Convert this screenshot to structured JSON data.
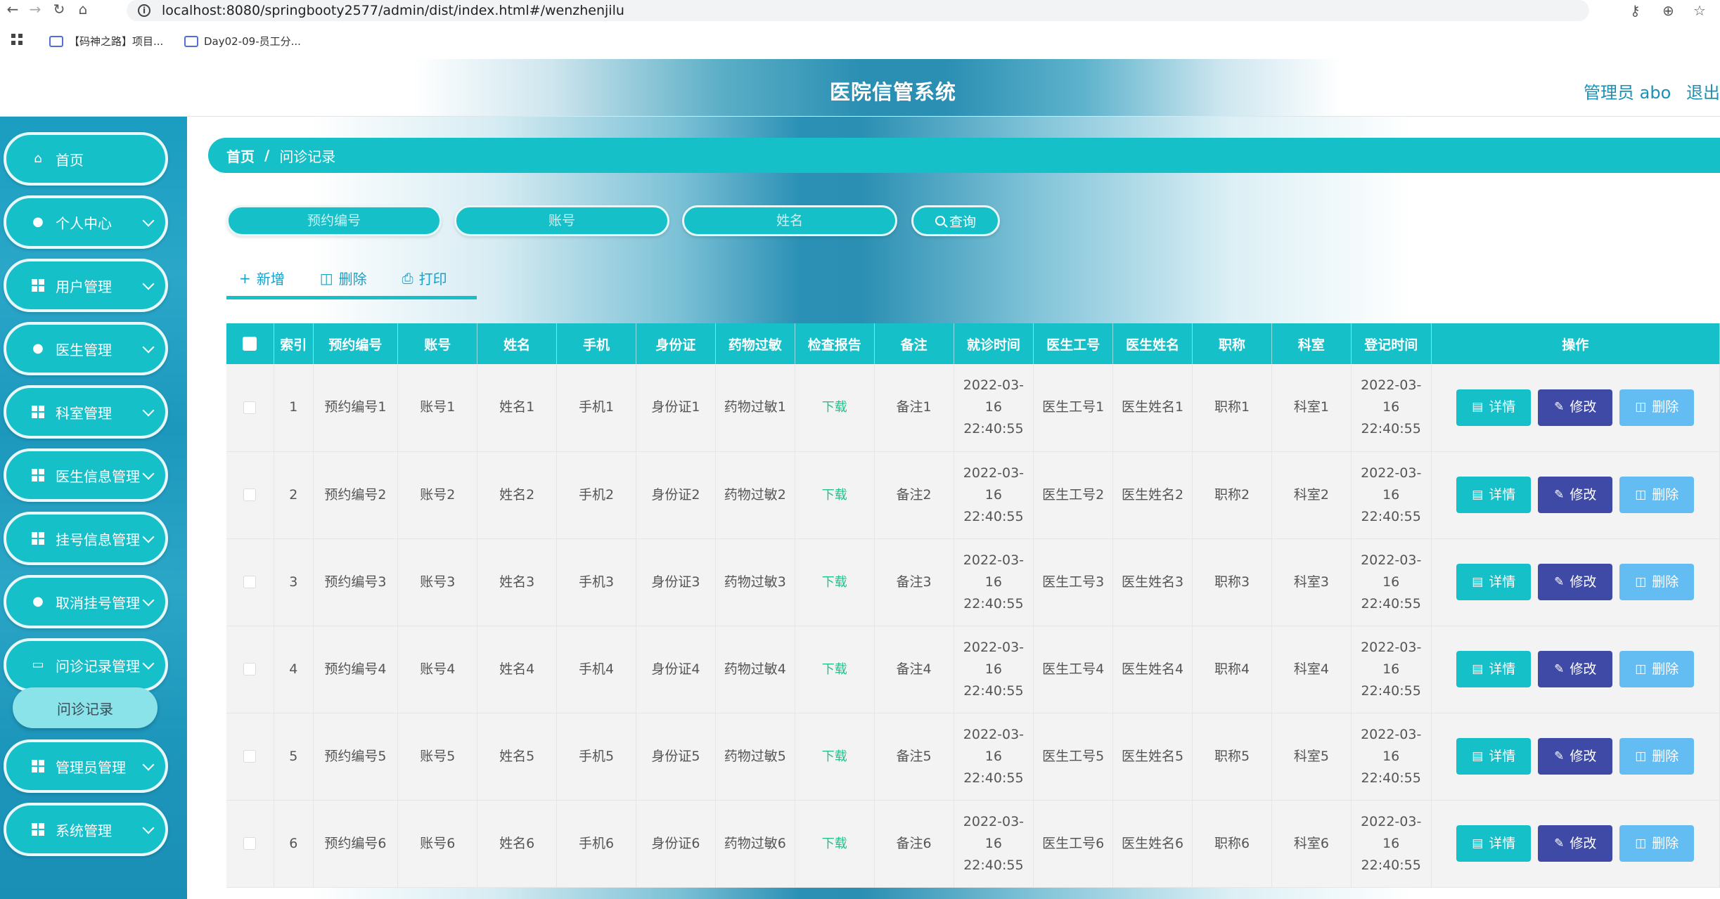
{
  "browser": {
    "url": "localhost:8080/springbooty2577/admin/dist/index.html#/wenzhenjilu",
    "bookmarks": [
      "【码神之路】项目...",
      "Day02-09-员工分..."
    ]
  },
  "header": {
    "title": "医院信管系统",
    "admin_label": "管理员 abo",
    "logout_label": "退出"
  },
  "sidebar": {
    "items": [
      {
        "label": "首页",
        "icon": "home-icon",
        "expandable": false
      },
      {
        "label": "个人中心",
        "icon": "person-icon",
        "expandable": true
      },
      {
        "label": "用户管理",
        "icon": "grid-icon",
        "expandable": true
      },
      {
        "label": "医生管理",
        "icon": "person-icon",
        "expandable": true
      },
      {
        "label": "科室管理",
        "icon": "grid-icon",
        "expandable": true
      },
      {
        "label": "医生信息管理",
        "icon": "grid-icon",
        "expandable": true
      },
      {
        "label": "挂号信息管理",
        "icon": "grid-icon",
        "expandable": true
      },
      {
        "label": "取消挂号管理",
        "icon": "bulb-icon",
        "expandable": true
      },
      {
        "label": "问诊记录管理",
        "icon": "monitor-icon",
        "expandable": true
      },
      {
        "label": "管理员管理",
        "icon": "table-icon",
        "expandable": true
      },
      {
        "label": "系统管理",
        "icon": "grid-icon",
        "expandable": true
      }
    ],
    "submenu_active": "问诊记录"
  },
  "breadcrumb": {
    "home": "首页",
    "separator": "/",
    "current": "问诊记录"
  },
  "search": {
    "field1_placeholder": "预约编号",
    "field2_placeholder": "账号",
    "field3_placeholder": "姓名",
    "query_label": "查询"
  },
  "toolbar": {
    "add_label": "新增",
    "delete_label": "删除",
    "print_label": "打印"
  },
  "table": {
    "columns": [
      "索引",
      "预约编号",
      "账号",
      "姓名",
      "手机",
      "身份证",
      "药物过敏",
      "检查报告",
      "备注",
      "就诊时间",
      "医生工号",
      "医生姓名",
      "职称",
      "科室",
      "登记时间",
      "操作"
    ],
    "rows": [
      {
        "index": "1",
        "booking_no": "预约编号1",
        "account": "账号1",
        "name": "姓名1",
        "phone": "手机1",
        "id_card": "身份证1",
        "allergy": "药物过敏1",
        "report": "下载",
        "remark": "备注1",
        "visit_time": "2022-03-16 22:40:55",
        "doctor_no": "医生工号1",
        "doctor_name": "医生姓名1",
        "title": "职称1",
        "dept": "科室1",
        "reg_time": "2022-03-16 22:40:55"
      },
      {
        "index": "2",
        "booking_no": "预约编号2",
        "account": "账号2",
        "name": "姓名2",
        "phone": "手机2",
        "id_card": "身份证2",
        "allergy": "药物过敏2",
        "report": "下载",
        "remark": "备注2",
        "visit_time": "2022-03-16 22:40:55",
        "doctor_no": "医生工号2",
        "doctor_name": "医生姓名2",
        "title": "职称2",
        "dept": "科室2",
        "reg_time": "2022-03-16 22:40:55"
      },
      {
        "index": "3",
        "booking_no": "预约编号3",
        "account": "账号3",
        "name": "姓名3",
        "phone": "手机3",
        "id_card": "身份证3",
        "allergy": "药物过敏3",
        "report": "下载",
        "remark": "备注3",
        "visit_time": "2022-03-16 22:40:55",
        "doctor_no": "医生工号3",
        "doctor_name": "医生姓名3",
        "title": "职称3",
        "dept": "科室3",
        "reg_time": "2022-03-16 22:40:55"
      },
      {
        "index": "4",
        "booking_no": "预约编号4",
        "account": "账号4",
        "name": "姓名4",
        "phone": "手机4",
        "id_card": "身份证4",
        "allergy": "药物过敏4",
        "report": "下载",
        "remark": "备注4",
        "visit_time": "2022-03-16 22:40:55",
        "doctor_no": "医生工号4",
        "doctor_name": "医生姓名4",
        "title": "职称4",
        "dept": "科室4",
        "reg_time": "2022-03-16 22:40:55"
      },
      {
        "index": "5",
        "booking_no": "预约编号5",
        "account": "账号5",
        "name": "姓名5",
        "phone": "手机5",
        "id_card": "身份证5",
        "allergy": "药物过敏5",
        "report": "下载",
        "remark": "备注5",
        "visit_time": "2022-03-16 22:40:55",
        "doctor_no": "医生工号5",
        "doctor_name": "医生姓名5",
        "title": "职称5",
        "dept": "科室5",
        "reg_time": "2022-03-16 22:40:55"
      },
      {
        "index": "6",
        "booking_no": "预约编号6",
        "account": "账号6",
        "name": "姓名6",
        "phone": "手机6",
        "id_card": "身份证6",
        "allergy": "药物过敏6",
        "report": "下载",
        "remark": "备注6",
        "visit_time": "2022-03-16 22:40:55",
        "doctor_no": "医生工号6",
        "doctor_name": "医生姓名6",
        "title": "职称6",
        "dept": "科室6",
        "reg_time": "2022-03-16 22:40:55"
      }
    ],
    "actions": {
      "detail": "详情",
      "edit": "修改",
      "delete": "删除"
    }
  },
  "colors": {
    "accent_teal": "#16c0c9",
    "edit_indigo": "#3f4aa6",
    "delete_blue": "#63bdf3",
    "download_green": "#23c18a",
    "header_blue": "#2b8fb3"
  }
}
